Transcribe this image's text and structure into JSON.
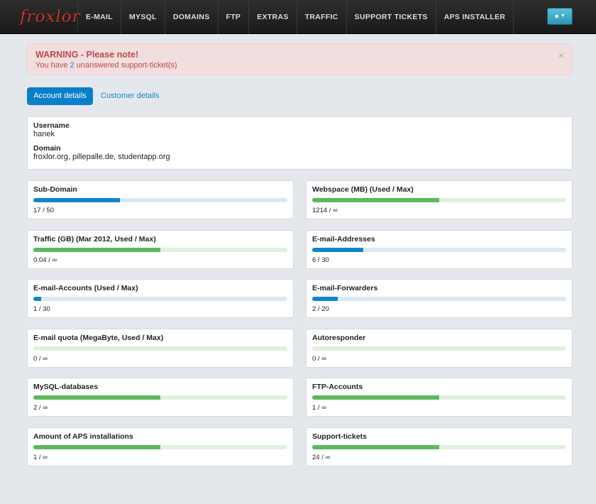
{
  "nav": {
    "brand": "froxlor",
    "items": [
      {
        "label": "E-MAIL",
        "name": "nav-email"
      },
      {
        "label": "MYSQL",
        "name": "nav-mysql"
      },
      {
        "label": "DOMAINS",
        "name": "nav-domains"
      },
      {
        "label": "FTP",
        "name": "nav-ftp"
      },
      {
        "label": "EXTRAS",
        "name": "nav-extras"
      },
      {
        "label": "TRAFFIC",
        "name": "nav-traffic"
      },
      {
        "label": "SUPPORT TICKETS",
        "name": "nav-support-tickets"
      },
      {
        "label": "APS INSTALLER",
        "name": "nav-aps-installer"
      }
    ],
    "user_icon": "user-icon",
    "caret_icon": "caret-down-icon"
  },
  "alert": {
    "title": "WARNING - Please note!",
    "text_before": "You have ",
    "count": "2",
    "text_after": " unanswered support-ticket(s)",
    "close": "×"
  },
  "tabs": {
    "active": "Account details",
    "other": "Customer details"
  },
  "account": {
    "username_label": "Username",
    "username": "hanek",
    "domain_label": "Domain",
    "domains": "froxlor.org, pillepalle.de, studentapp.org"
  },
  "stats": [
    {
      "title": "Sub-Domain",
      "value": "17 / 50",
      "fill_pct": 34,
      "color": "blue"
    },
    {
      "title": "Webspace (MB) (Used / Max)",
      "value": "1214 / ∞",
      "fill_pct": 50,
      "color": "green"
    },
    {
      "title": "Traffic (GB) (Mar 2012, Used / Max)",
      "value": "0.04 / ∞",
      "fill_pct": 50,
      "color": "green"
    },
    {
      "title": "E-mail-Addresses",
      "value": "6 / 30",
      "fill_pct": 20,
      "color": "blue"
    },
    {
      "title": "E-mail-Accounts (Used / Max)",
      "value": "1 / 30",
      "fill_pct": 3,
      "color": "blue"
    },
    {
      "title": "E-mail-Forwarders",
      "value": "2 / 20",
      "fill_pct": 10,
      "color": "blue"
    },
    {
      "title": "E-mail quota (MegaByte, Used / Max)",
      "value": "0 / ∞",
      "fill_pct": 0,
      "color": "green"
    },
    {
      "title": "Autoresponder",
      "value": "0 / ∞",
      "fill_pct": 0,
      "color": "green"
    },
    {
      "title": "MySQL-databases",
      "value": "2 / ∞",
      "fill_pct": 50,
      "color": "green"
    },
    {
      "title": "FTP-Accounts",
      "value": "1 / ∞",
      "fill_pct": 50,
      "color": "green"
    },
    {
      "title": "Amount of APS installations",
      "value": "1 / ∞",
      "fill_pct": 50,
      "color": "green"
    },
    {
      "title": "Support-tickets",
      "value": "24 / ∞",
      "fill_pct": 50,
      "color": "green"
    }
  ]
}
